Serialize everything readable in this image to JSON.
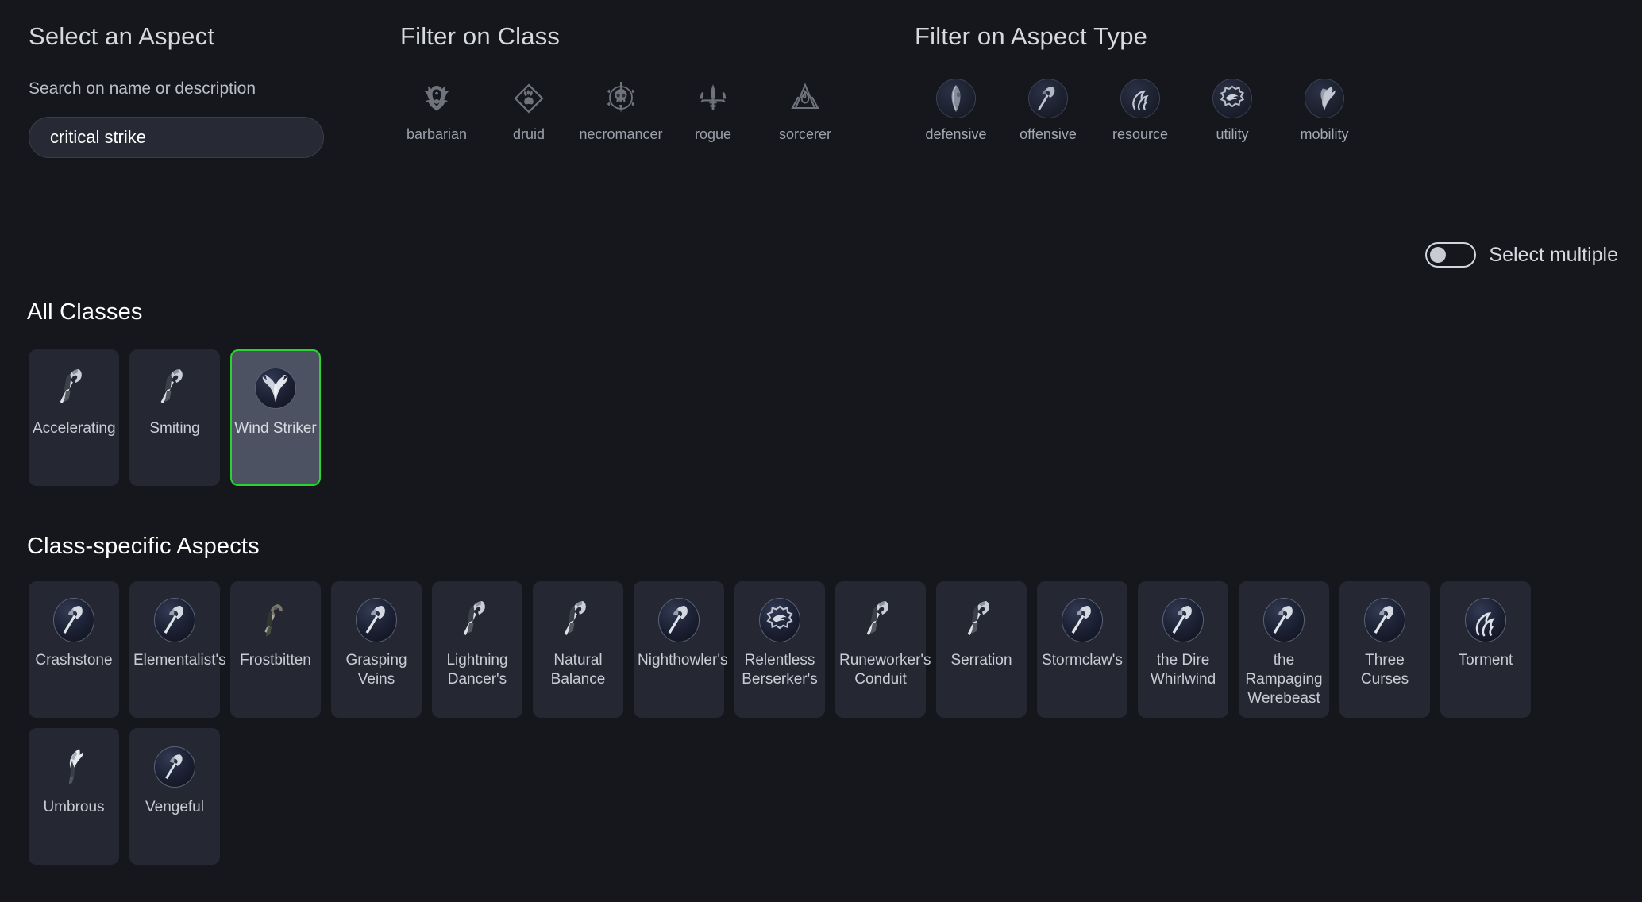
{
  "panels": {
    "select_aspect_title": "Select an Aspect",
    "search_label": "Search on name or description",
    "search_value": "critical strike",
    "search_placeholder": "Search on name or description",
    "filter_class_title": "Filter on Class",
    "filter_type_title": "Filter on Aspect Type"
  },
  "class_filters": [
    {
      "label": "barbarian",
      "icon": "barbarian-helm-icon"
    },
    {
      "label": "druid",
      "icon": "druid-paw-icon"
    },
    {
      "label": "necromancer",
      "icon": "necromancer-skull-icon"
    },
    {
      "label": "rogue",
      "icon": "rogue-crossbow-icon"
    },
    {
      "label": "sorcerer",
      "icon": "sorcerer-flame-icon"
    }
  ],
  "type_filters": [
    {
      "label": "defensive",
      "icon": "shield-orb-icon"
    },
    {
      "label": "offensive",
      "icon": "axe-orb-icon"
    },
    {
      "label": "resource",
      "icon": "swirl-orb-icon"
    },
    {
      "label": "utility",
      "icon": "gear-orb-icon"
    },
    {
      "label": "mobility",
      "icon": "feather-orb-icon"
    }
  ],
  "select_multiple": {
    "label": "Select multiple",
    "enabled": false
  },
  "sections": {
    "all_classes_title": "All Classes",
    "class_specific_title": "Class-specific Aspects"
  },
  "colors": {
    "page_background": "#15171c",
    "card_background": "#252833",
    "card_selected_background": "#4c5261",
    "selection_border": "#2ad430",
    "input_background": "#272a35",
    "heading_text": "#ffffff",
    "muted_text": "#9ba0ab"
  },
  "all_classes_aspects": [
    {
      "name": "Accelerating",
      "art": "axe-plain",
      "selected": false
    },
    {
      "name": "Smiting",
      "art": "axe-plain",
      "selected": false
    },
    {
      "name": "Wind Striker",
      "art": "feather-orb",
      "selected": true
    }
  ],
  "class_specific_aspects": [
    {
      "name": "Crashstone",
      "art": "axe-orb"
    },
    {
      "name": "Elementalist's",
      "art": "axe-orb"
    },
    {
      "name": "Frostbitten",
      "art": "dark-plain"
    },
    {
      "name": "Grasping Veins",
      "art": "axe-orb"
    },
    {
      "name": "Lightning Dancer's",
      "art": "axe-plain"
    },
    {
      "name": "Natural Balance",
      "art": "axe-plain"
    },
    {
      "name": "Nighthowler's",
      "art": "axe-orb"
    },
    {
      "name": "Relentless Berserker's",
      "art": "gear-orb"
    },
    {
      "name": "Runeworker's Conduit",
      "art": "axe-plain"
    },
    {
      "name": "Serration",
      "art": "axe-plain"
    },
    {
      "name": "Stormclaw's",
      "art": "axe-orb"
    },
    {
      "name": "the Dire Whirlwind",
      "art": "axe-orb"
    },
    {
      "name": "the Rampaging Werebeast",
      "art": "axe-orb"
    },
    {
      "name": "Three Curses",
      "art": "axe-orb"
    },
    {
      "name": "Torment",
      "art": "swirl-orb"
    },
    {
      "name": "Umbrous",
      "art": "feather-plain"
    },
    {
      "name": "Vengeful",
      "art": "axe-orb-round"
    }
  ]
}
